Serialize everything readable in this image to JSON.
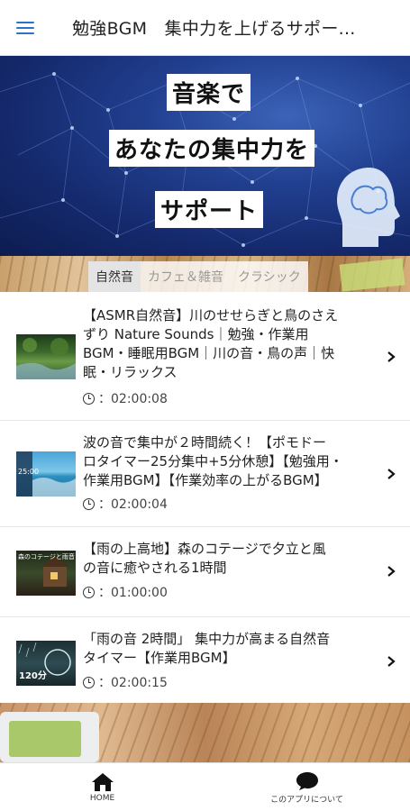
{
  "header": {
    "menu_icon": "hamburger-menu-icon",
    "title": "勉強BGM　集中力を上げるサポー..."
  },
  "banner": {
    "lines": [
      "音楽で",
      "あなたの集中力を",
      "サポート"
    ],
    "icon": "head-silhouette-icon"
  },
  "tabs": [
    {
      "label": "自然音",
      "active": true
    },
    {
      "label": "カフェ＆雑音",
      "active": false
    },
    {
      "label": "クラシック",
      "active": false
    }
  ],
  "videos": [
    {
      "title_lines": [
        "【ASMR自然音】川のせせらぎと鳥のさえ",
        "ずり Nature Sounds｜勉強・作業用",
        "BGM・睡眠用BGM｜川の音・鳥の声｜快",
        "眠・リラックス"
      ],
      "duration": "：02:00:08",
      "thumb_icon": "forest-river-thumbnail"
    },
    {
      "title_lines": [
        "波の音で集中が２時間続く！【ポモドー",
        "ロタイマー25分集中+5分休憩】【勉強用・",
        "作業用BGM】【作業効率の上がるBGM】"
      ],
      "duration": "：02:00:04",
      "thumb_icon": "ocean-wave-thumbnail",
      "thumb_text": "25:00"
    },
    {
      "title_lines": [
        "【雨の上高地】森のコテージで夕立と風",
        "の音に癒やされる1時間"
      ],
      "duration": "：01:00:00",
      "thumb_icon": "forest-cottage-thumbnail",
      "thumb_text": "森のコテージと雨音"
    },
    {
      "title_lines": [
        "「雨の音 2時間」 集中力が高まる自然音",
        "タイマー【作業用BGM】"
      ],
      "duration": "：02:00:15",
      "thumb_icon": "rain-timer-thumbnail",
      "thumb_text": "120分"
    }
  ],
  "bottom_nav": [
    {
      "label": "HOME",
      "icon": "home-icon"
    },
    {
      "label": "このアプリについて",
      "icon": "chat-bubble-icon"
    }
  ],
  "colors": {
    "accent": "#2a73c8",
    "banner_bg": "#14286a"
  }
}
